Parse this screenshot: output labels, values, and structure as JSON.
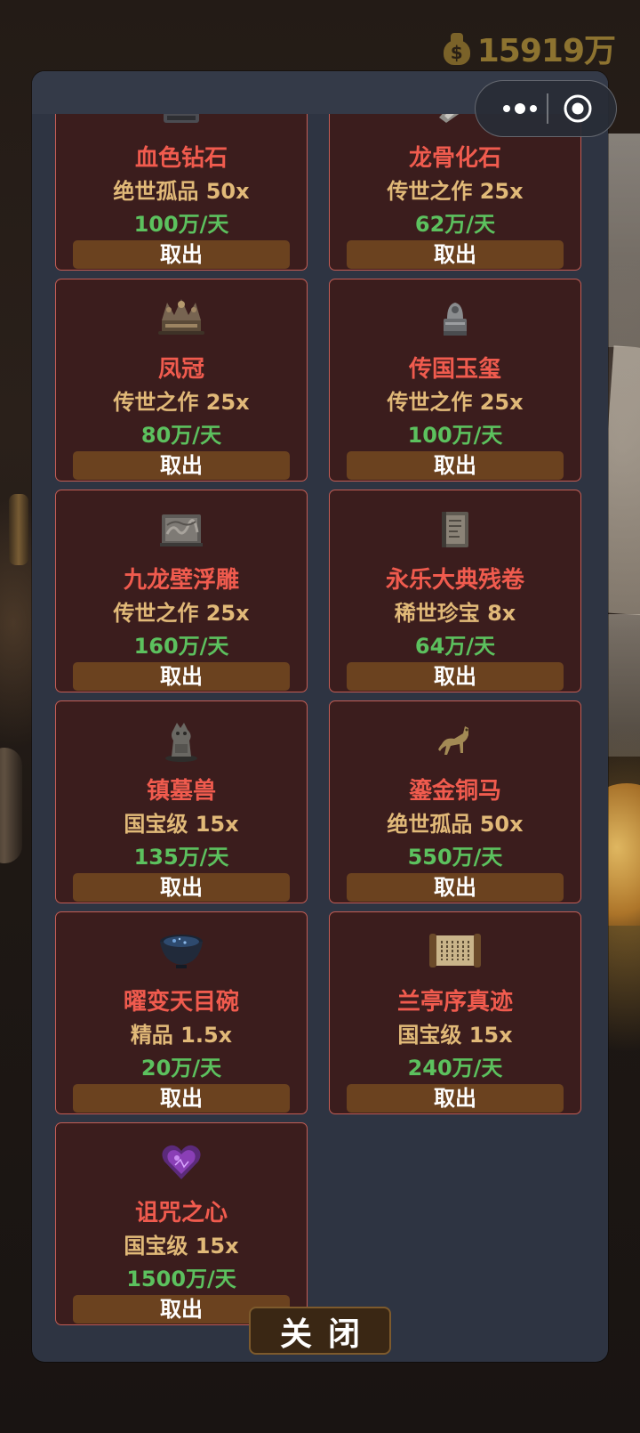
{
  "balance": "15919万",
  "colors": {
    "card_bg": "#3b1d1d",
    "card_border": "#c35d55",
    "item_name": "#f05b4e",
    "grade": "#e1b978",
    "rate": "#5cc15e",
    "take_button": "#6b421f",
    "panel_bg": "#2e3442"
  },
  "items": [
    {
      "name": "血色钻石",
      "grade": "绝世孤品 50x",
      "rate": "100万/天",
      "action": "取出",
      "icon": "ruby-gem-icon"
    },
    {
      "name": "龙骨化石",
      "grade": "传世之作 25x",
      "rate": "62万/天",
      "action": "取出",
      "icon": "fossil-icon"
    },
    {
      "name": "凤冠",
      "grade": "传世之作 25x",
      "rate": "80万/天",
      "action": "取出",
      "icon": "crown-icon"
    },
    {
      "name": "传国玉玺",
      "grade": "传世之作 25x",
      "rate": "100万/天",
      "action": "取出",
      "icon": "jade-seal-icon"
    },
    {
      "name": "九龙壁浮雕",
      "grade": "传世之作 25x",
      "rate": "160万/天",
      "action": "取出",
      "icon": "relief-panel-icon"
    },
    {
      "name": "永乐大典残卷",
      "grade": "稀世珍宝 8x",
      "rate": "64万/天",
      "action": "取出",
      "icon": "ancient-book-icon"
    },
    {
      "name": "镇墓兽",
      "grade": "国宝级 15x",
      "rate": "135万/天",
      "action": "取出",
      "icon": "tomb-beast-icon"
    },
    {
      "name": "鎏金铜马",
      "grade": "绝世孤品 50x",
      "rate": "550万/天",
      "action": "取出",
      "icon": "bronze-horse-icon"
    },
    {
      "name": "曜变天目碗",
      "grade": "精品 1.5x",
      "rate": "20万/天",
      "action": "取出",
      "icon": "tea-bowl-icon"
    },
    {
      "name": "兰亭序真迹",
      "grade": "国宝级 15x",
      "rate": "240万/天",
      "action": "取出",
      "icon": "scroll-icon"
    },
    {
      "name": "诅咒之心",
      "grade": "国宝级 15x",
      "rate": "1500万/天",
      "action": "取出",
      "icon": "cursed-heart-icon"
    }
  ],
  "close_label": "关闭"
}
